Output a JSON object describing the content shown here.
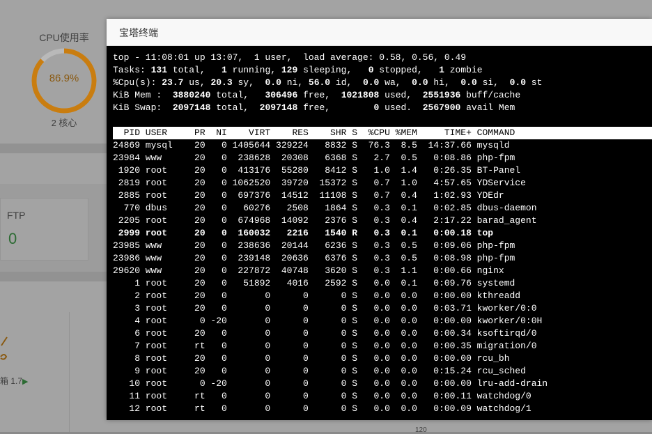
{
  "background": {
    "cpu": {
      "title": "CPU使用率",
      "value": "86.9%",
      "percent": 86.9,
      "cores": "2 核心",
      "ring_color": "#c97d10"
    },
    "ftp": {
      "label": "FTP",
      "count": "0"
    },
    "mailbox_label": "箱 1.7",
    "axis_number": "120"
  },
  "dialog": {
    "title": "宝塔终端"
  },
  "terminal": {
    "summary": {
      "top_line": "top - 11:08:01 up 13:07,  1 user,  load average: 0.58, 0.56, 0.49",
      "tasks": {
        "label": "Tasks:",
        "total": "131",
        "running": "1",
        "sleeping": "129",
        "stopped": "0",
        "zombie": "1"
      },
      "cpu": {
        "label": "%Cpu(s):",
        "us": "23.7",
        "sy": "20.3",
        "ni": "0.0",
        "id": "56.0",
        "wa": "0.0",
        "hi": "0.0",
        "si": "0.0",
        "st": "0.0"
      },
      "mem": {
        "label": "KiB Mem :",
        "total": "3880240",
        "free": "306496",
        "used": "1021808",
        "buff_cache": "2551936"
      },
      "swap": {
        "label": "KiB Swap:",
        "total": "2097148",
        "free": "2097148",
        "used": "0",
        "avail": "2567900"
      }
    },
    "columns": [
      "PID",
      "USER",
      "PR",
      "NI",
      "VIRT",
      "RES",
      "SHR",
      "S",
      "%CPU",
      "%MEM",
      "TIME+",
      "COMMAND"
    ],
    "processes": [
      [
        "24869",
        "mysql",
        "20",
        "0",
        "1405644",
        "329224",
        "8832",
        "S",
        "76.3",
        "8.5",
        "14:37.66",
        "mysqld"
      ],
      [
        "23984",
        "www",
        "20",
        "0",
        "238628",
        "20308",
        "6368",
        "S",
        "2.7",
        "0.5",
        "0:08.86",
        "php-fpm"
      ],
      [
        "1920",
        "root",
        "20",
        "0",
        "413176",
        "55280",
        "8412",
        "S",
        "1.0",
        "1.4",
        "0:26.35",
        "BT-Panel"
      ],
      [
        "2819",
        "root",
        "20",
        "0",
        "1062520",
        "39720",
        "15372",
        "S",
        "0.7",
        "1.0",
        "4:57.65",
        "YDService"
      ],
      [
        "2885",
        "root",
        "20",
        "0",
        "697376",
        "14512",
        "11108",
        "S",
        "0.7",
        "0.4",
        "1:02.93",
        "YDEdr"
      ],
      [
        "770",
        "dbus",
        "20",
        "0",
        "60276",
        "2508",
        "1864",
        "S",
        "0.3",
        "0.1",
        "0:02.85",
        "dbus-daemon"
      ],
      [
        "2205",
        "root",
        "20",
        "0",
        "674968",
        "14092",
        "2376",
        "S",
        "0.3",
        "0.4",
        "2:17.22",
        "barad_agent"
      ],
      [
        "2999",
        "root",
        "20",
        "0",
        "160032",
        "2216",
        "1540",
        "R",
        "0.3",
        "0.1",
        "0:00.18",
        "top"
      ],
      [
        "23985",
        "www",
        "20",
        "0",
        "238636",
        "20144",
        "6236",
        "S",
        "0.3",
        "0.5",
        "0:09.06",
        "php-fpm"
      ],
      [
        "23986",
        "www",
        "20",
        "0",
        "239148",
        "20636",
        "6376",
        "S",
        "0.3",
        "0.5",
        "0:08.98",
        "php-fpm"
      ],
      [
        "29620",
        "www",
        "20",
        "0",
        "227872",
        "40748",
        "3620",
        "S",
        "0.3",
        "1.1",
        "0:00.66",
        "nginx"
      ],
      [
        "1",
        "root",
        "20",
        "0",
        "51892",
        "4016",
        "2592",
        "S",
        "0.0",
        "0.1",
        "0:09.76",
        "systemd"
      ],
      [
        "2",
        "root",
        "20",
        "0",
        "0",
        "0",
        "0",
        "S",
        "0.0",
        "0.0",
        "0:00.00",
        "kthreadd"
      ],
      [
        "3",
        "root",
        "20",
        "0",
        "0",
        "0",
        "0",
        "S",
        "0.0",
        "0.0",
        "0:03.71",
        "kworker/0:0"
      ],
      [
        "4",
        "root",
        "0",
        "-20",
        "0",
        "0",
        "0",
        "S",
        "0.0",
        "0.0",
        "0:00.00",
        "kworker/0:0H"
      ],
      [
        "6",
        "root",
        "20",
        "0",
        "0",
        "0",
        "0",
        "S",
        "0.0",
        "0.0",
        "0:00.34",
        "ksoftirqd/0"
      ],
      [
        "7",
        "root",
        "rt",
        "0",
        "0",
        "0",
        "0",
        "S",
        "0.0",
        "0.0",
        "0:00.35",
        "migration/0"
      ],
      [
        "8",
        "root",
        "20",
        "0",
        "0",
        "0",
        "0",
        "S",
        "0.0",
        "0.0",
        "0:00.00",
        "rcu_bh"
      ],
      [
        "9",
        "root",
        "20",
        "0",
        "0",
        "0",
        "0",
        "S",
        "0.0",
        "0.0",
        "0:15.24",
        "rcu_sched"
      ],
      [
        "10",
        "root",
        "0",
        "-20",
        "0",
        "0",
        "0",
        "S",
        "0.0",
        "0.0",
        "0:00.00",
        "lru-add-drain"
      ],
      [
        "11",
        "root",
        "rt",
        "0",
        "0",
        "0",
        "0",
        "S",
        "0.0",
        "0.0",
        "0:00.11",
        "watchdog/0"
      ],
      [
        "12",
        "root",
        "rt",
        "0",
        "0",
        "0",
        "0",
        "S",
        "0.0",
        "0.0",
        "0:00.09",
        "watchdog/1"
      ]
    ],
    "highlight_command": "top"
  }
}
